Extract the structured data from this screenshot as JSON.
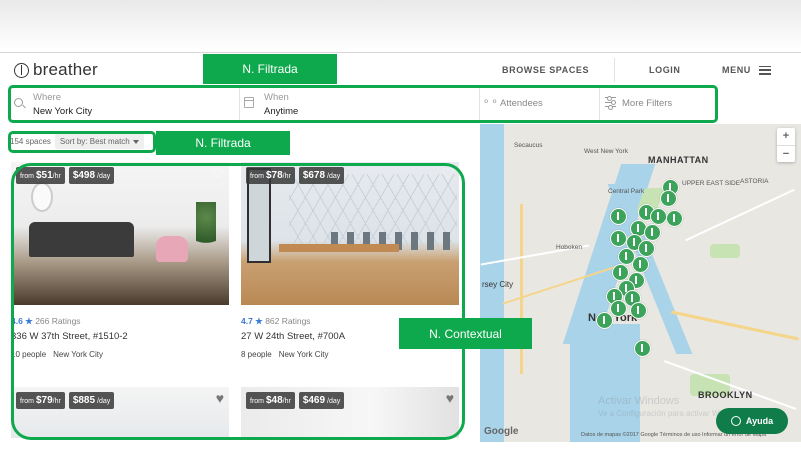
{
  "header": {
    "logo_text": "breather",
    "nav": {
      "browse": "BROWSE SPACES",
      "login": "LOGIN",
      "menu": "MENU"
    }
  },
  "search": {
    "where_label": "Where",
    "where_value": "New York City",
    "when_label": "When",
    "when_value": "Anytime",
    "attendees": "Attendees",
    "more_filters": "More Filters"
  },
  "results": {
    "count": "154 spaces",
    "sort_label": "Sort by:",
    "sort_value": "Best match"
  },
  "listings": [
    {
      "hourly_prefix": "from",
      "hourly": "$51",
      "hourly_unit": "/hr",
      "daily": "$498",
      "daily_unit": "/day",
      "rating": "4.6 ★",
      "ratings_count": "266 Ratings",
      "address": "336 W 37th Street, #1510-2",
      "people": "10 people",
      "city": "New York City"
    },
    {
      "hourly_prefix": "from",
      "hourly": "$78",
      "hourly_unit": "/hr",
      "daily": "$678",
      "daily_unit": "/day",
      "rating": "4.7 ★",
      "ratings_count": "862 Ratings",
      "address": "27 W 24th Street, #700A",
      "people": "8 people",
      "city": "New York City"
    },
    {
      "hourly_prefix": "from",
      "hourly": "$79",
      "hourly_unit": "/hr",
      "daily": "$885",
      "daily_unit": "/day"
    },
    {
      "hourly_prefix": "from",
      "hourly": "$48",
      "hourly_unit": "/hr",
      "daily": "$469",
      "daily_unit": "/day"
    }
  ],
  "map": {
    "labels": {
      "secaucus": "Secaucus",
      "west_new_york": "West New York",
      "manhattan": "MANHATTAN",
      "central_park": "Central Park",
      "hoboken": "Hoboken",
      "jersey_city": "rsey City",
      "new_york": "New York",
      "brooklyn": "BROOKLYN",
      "astoria": "ASTORIA",
      "upper_east": "UPPER EAST SIDE"
    },
    "zoom_in": "+",
    "zoom_out": "−",
    "google": "Google",
    "attribution": "Datos de mapas ©2017 Google   Términos de uso   Informar un error de Mapa",
    "watermark_line1": "Activar Windows",
    "watermark_line2": "Ve a Configuración para activar Windows."
  },
  "help_button": "Ayuda",
  "annotations": {
    "search_tag": "N. Filtrada",
    "results_tag": "N. Filtrada",
    "cards_tag": "N. Contextual"
  },
  "colors": {
    "annotation_green": "#0ea94c",
    "pin_green": "#3ba35a",
    "rating_blue": "#3a7bd5",
    "help_green": "#0f7c4a"
  }
}
